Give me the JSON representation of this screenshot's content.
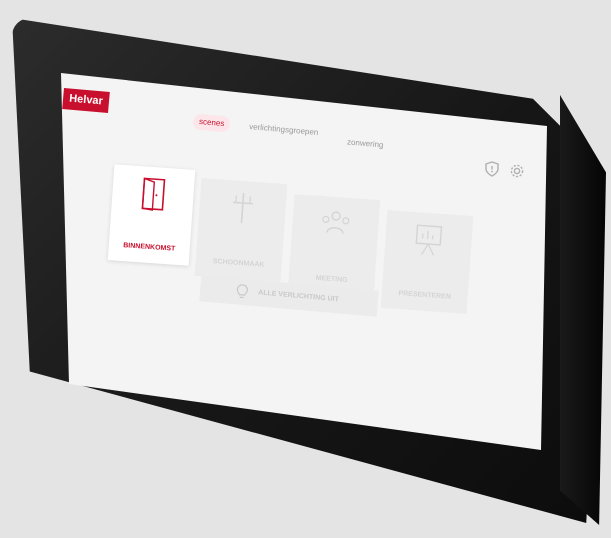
{
  "brand": {
    "logo_text": "Helvar",
    "accent": "#c8102e"
  },
  "tabs": [
    {
      "label": "scenes",
      "active": true
    },
    {
      "label": "verlichtingsgroepen",
      "active": false
    },
    {
      "label": "zonwering",
      "active": false
    }
  ],
  "status_icons": [
    "shield-icon",
    "gear-icon"
  ],
  "scenes": [
    {
      "label": "BINNENKOMST",
      "icon": "door-icon",
      "active": true
    },
    {
      "label": "SCHOONMAAK",
      "icon": "cleaning-icon",
      "active": false
    },
    {
      "label": "MEETING",
      "icon": "people-icon",
      "active": false
    },
    {
      "label": "PRESENTEREN",
      "icon": "presentation-icon",
      "active": false
    }
  ],
  "all_off": {
    "label": "ALLE VERLICHTING UIT",
    "icon": "lightbulb-icon"
  }
}
